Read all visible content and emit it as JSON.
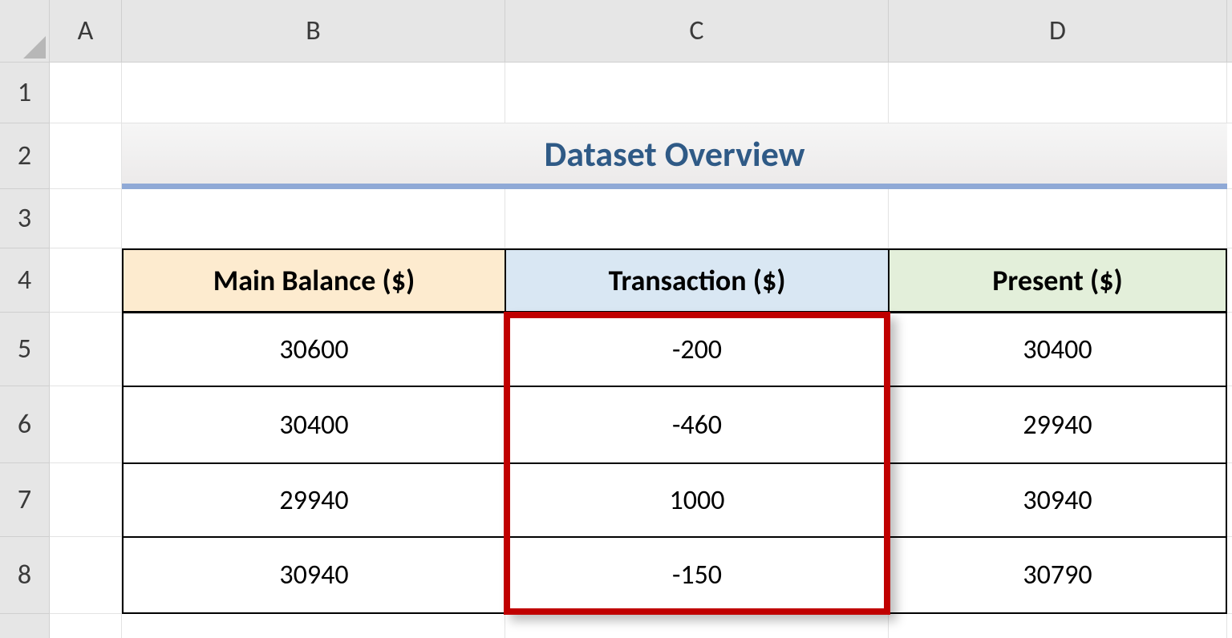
{
  "columns": {
    "A": "A",
    "B": "B",
    "C": "C",
    "D": "D"
  },
  "rows": {
    "1": "1",
    "2": "2",
    "3": "3",
    "4": "4",
    "5": "5",
    "6": "6",
    "7": "7",
    "8": "8"
  },
  "title": "Dataset Overview",
  "headers": {
    "b": "Main Balance ($)",
    "c": "Transaction ($)",
    "d": "Present ($)"
  },
  "data": {
    "r5": {
      "b": "30600",
      "c": "-200",
      "d": "30400"
    },
    "r6": {
      "b": "30400",
      "c": "-460",
      "d": "29940"
    },
    "r7": {
      "b": "29940",
      "c": "1000",
      "d": "30940"
    },
    "r8": {
      "b": "30940",
      "c": "-150",
      "d": "30790"
    }
  },
  "chart_data": {
    "type": "table",
    "title": "Dataset Overview",
    "columns": [
      "Main Balance ($)",
      "Transaction ($)",
      "Present ($)"
    ],
    "rows": [
      [
        30600,
        -200,
        30400
      ],
      [
        30400,
        -460,
        29940
      ],
      [
        29940,
        1000,
        30940
      ],
      [
        30940,
        -150,
        30790
      ]
    ],
    "highlighted_range": "C5:C8"
  }
}
